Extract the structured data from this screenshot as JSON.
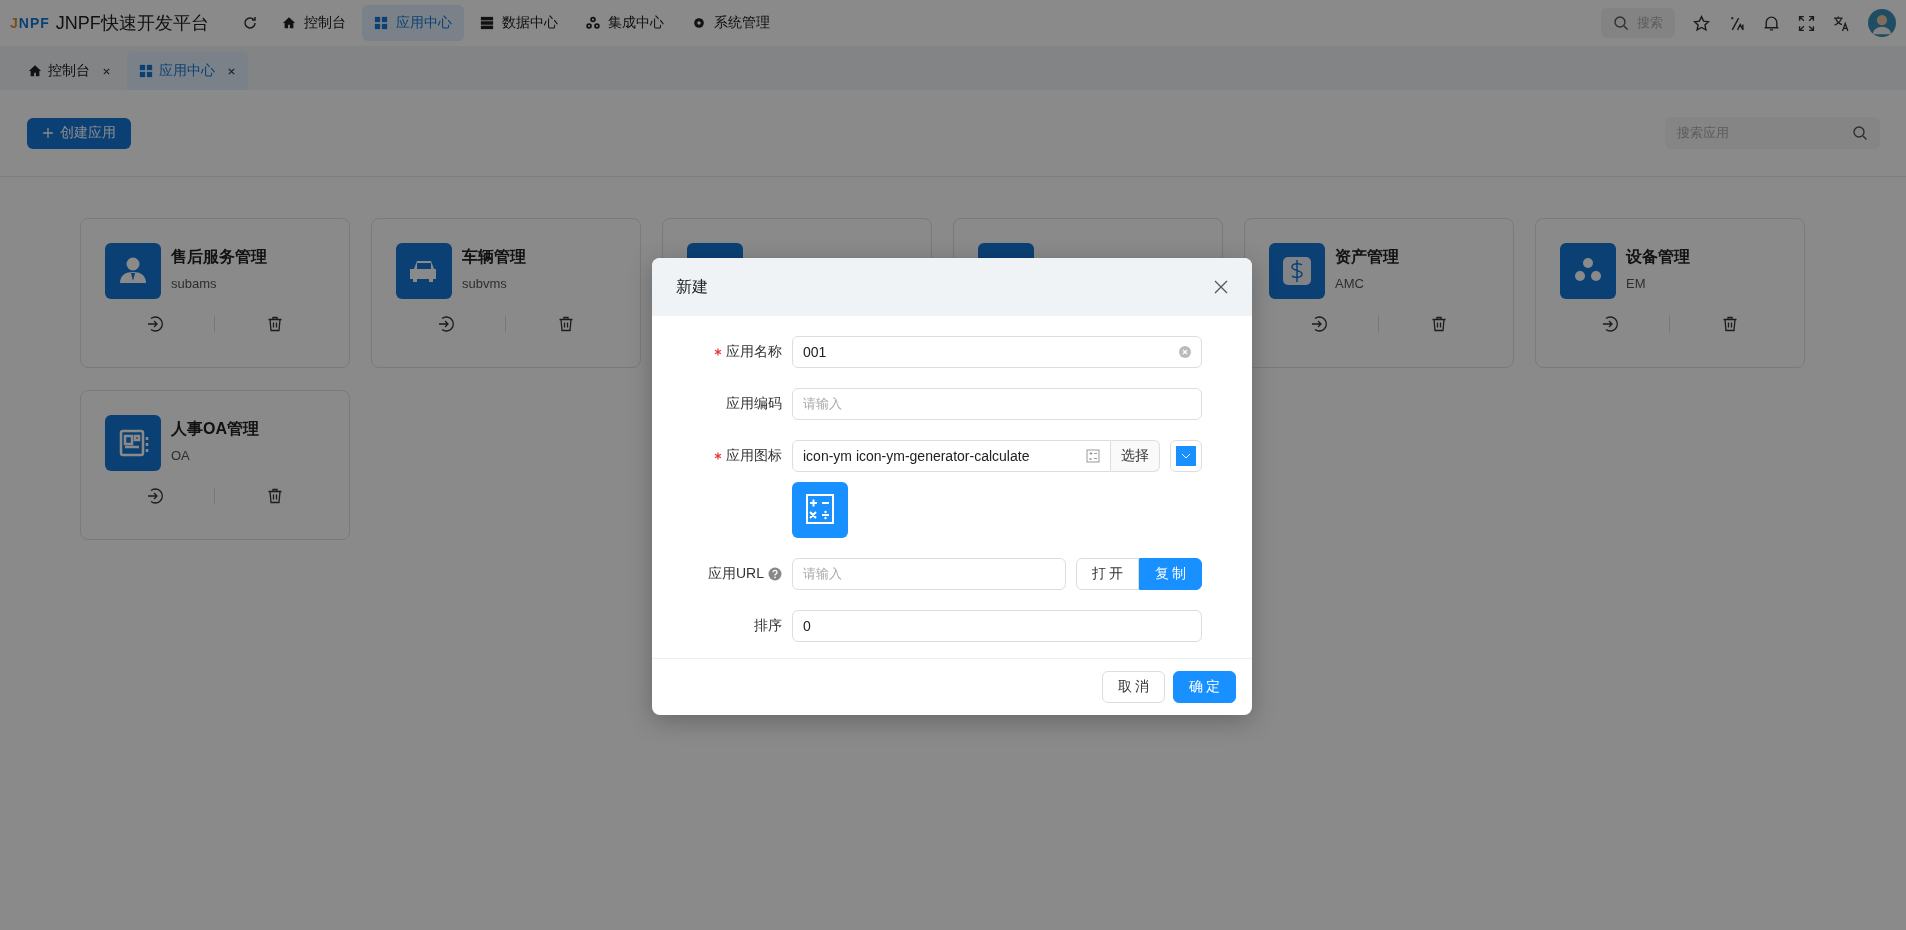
{
  "header": {
    "logo_mark": "JNPF",
    "title": "JNPF快速开发平台",
    "nav": [
      {
        "label": "控制台",
        "selected": false
      },
      {
        "label": "应用中心",
        "selected": true
      },
      {
        "label": "数据中心",
        "selected": false
      },
      {
        "label": "集成中心",
        "selected": false
      },
      {
        "label": "系统管理",
        "selected": false
      }
    ],
    "search": {
      "placeholder": "搜索"
    }
  },
  "tabs": [
    {
      "label": "控制台",
      "selected": false
    },
    {
      "label": "应用中心",
      "selected": true
    }
  ],
  "toolbar": {
    "create_button": "创建应用",
    "search": {
      "placeholder": "搜索应用"
    }
  },
  "apps": [
    {
      "name": "售后服务管理",
      "code": "subams"
    },
    {
      "name": "车辆管理",
      "code": "subvms"
    },
    {
      "partial": true
    },
    {
      "partial": true
    },
    {
      "name": "资产管理",
      "code": "AMC"
    },
    {
      "name": "设备管理",
      "code": "EM"
    },
    {
      "name": "人事OA管理",
      "code": "OA"
    }
  ],
  "dialog": {
    "title": "新建",
    "fields": [
      {
        "kind": "text",
        "label": "应用名称",
        "required": true,
        "value": "001",
        "clearable": true
      },
      {
        "kind": "text",
        "label": "应用编码",
        "required": false,
        "placeholder": "请输入",
        "clearable": false
      },
      {
        "kind": "icon",
        "label": "应用图标",
        "required": true,
        "value": "icon-ym icon-ym-generator-calculate",
        "button": "选择"
      },
      {
        "kind": "url",
        "label": "应用URL",
        "required": false,
        "placeholder": "请输入",
        "buttons": [
          {
            "label": "打 开",
            "primary": false
          },
          {
            "label": "复 制",
            "primary": true
          }
        ]
      },
      {
        "kind": "text",
        "label": "排序",
        "required": false,
        "value": "0",
        "clearable": false
      }
    ],
    "buttons": [
      {
        "label": "取 消",
        "primary": false
      },
      {
        "label": "确 定",
        "primary": true
      }
    ]
  }
}
